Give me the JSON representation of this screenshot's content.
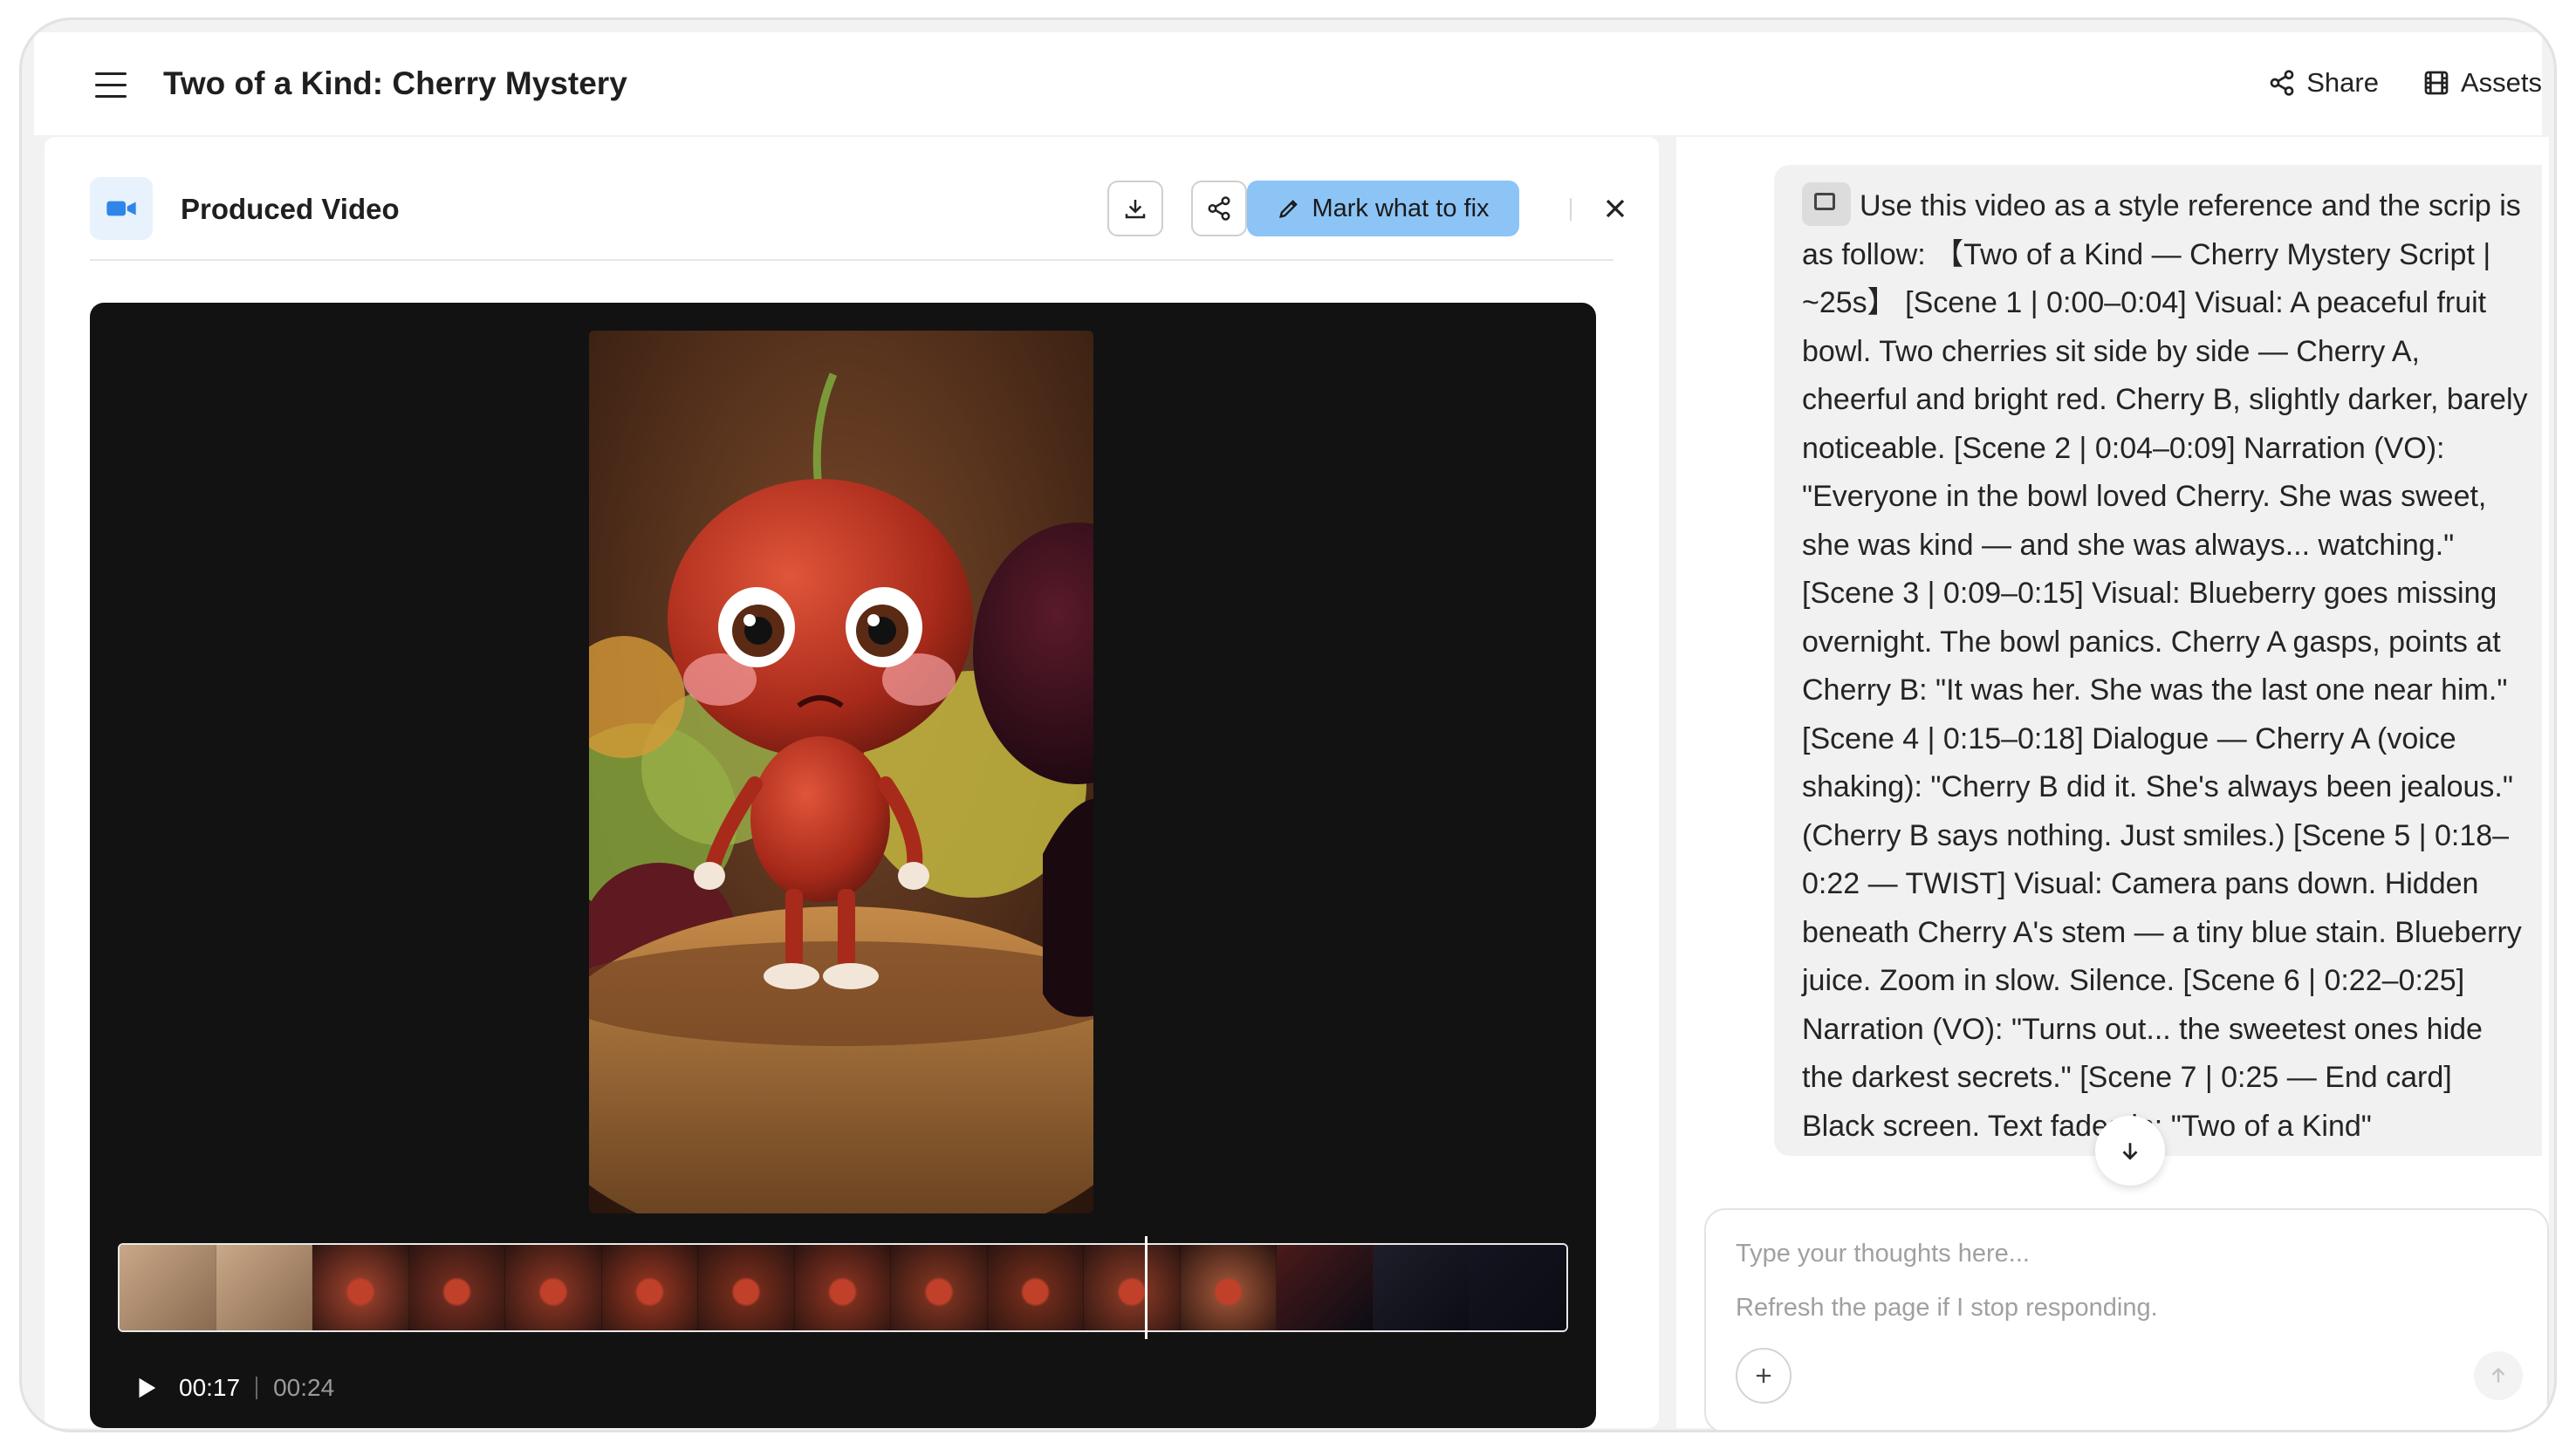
{
  "app": {
    "title": "Two of a Kind: Cherry Mystery",
    "actions": {
      "share_label": "Share",
      "assets_label": "Assets"
    }
  },
  "video_panel": {
    "title": "Produced Video",
    "mark_fix_label": "Mark what to fix",
    "player": {
      "current_time": "00:17",
      "total_time": "00:24",
      "progress": 0.7083,
      "timeline_thumbnail_count": 15
    }
  },
  "chat": {
    "user_message": "Use this video as a style reference and the scrip is as follow: 【Two of a Kind — Cherry Mystery Script | ~25s】 [Scene 1 | 0:00–0:04] Visual: A peaceful fruit bowl. Two cherries sit side by side — Cherry A, cheerful and bright red. Cherry B, slightly darker, barely noticeable. [Scene 2 | 0:04–0:09] Narration (VO): \"Everyone in the bowl loved Cherry. She was sweet, she was kind — and she was always... watching.\" [Scene 3 | 0:09–0:15] Visual: Blueberry goes missing overnight. The bowl panics. Cherry A gasps, points at Cherry B: \"It was her. She was the last one near him.\" [Scene 4 | 0:15–0:18] Dialogue — Cherry A (voice shaking): \"Cherry B did it. She's always been jealous.\" (Cherry B says nothing. Just smiles.) [Scene 5 | 0:18–0:22 — TWIST] Visual: Camera pans down. Hidden beneath Cherry A's stem — a tiny blue stain. Blueberry juice. Zoom in slow. Silence. [Scene 6 | 0:22–0:25] Narration (VO): \"Turns out... the sweetest ones hide the darkest secrets.\" [Scene 7 | 0:25 — End card] Black screen. Text fades in: \"Two of a Kind\"",
    "composer": {
      "placeholder": "Type your thoughts here...",
      "hint": "Refresh the page if I stop responding."
    }
  },
  "icons": {
    "menu": "menu-icon",
    "share": "share-icon",
    "assets": "film-icon",
    "video": "video-camera-icon",
    "download": "download-icon",
    "share_small": "share-icon",
    "pencil": "pencil-icon",
    "close": "close-icon",
    "play": "play-icon",
    "scroll_down": "arrow-down-icon",
    "add": "plus-icon",
    "send": "arrow-up-icon",
    "attachment": "video-attachment-icon"
  },
  "colors": {
    "accent": "#8cc4f6",
    "video_badge": "#2f86e8",
    "player_bg": "#121212",
    "bubble_bg": "#f1f1f1"
  }
}
